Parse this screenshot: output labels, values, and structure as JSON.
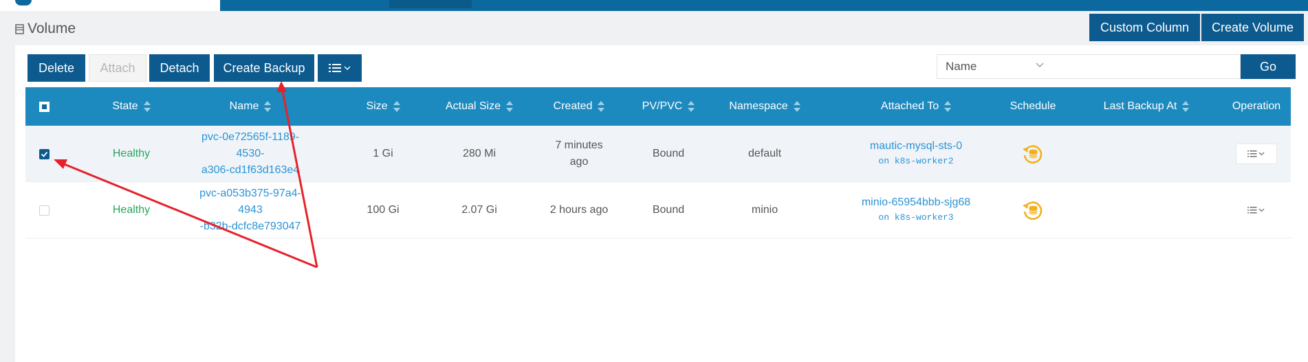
{
  "page": {
    "title": "Volume",
    "custom_column": "Custom Column",
    "create_volume": "Create Volume"
  },
  "toolbar": {
    "delete": "Delete",
    "attach": "Attach",
    "detach": "Detach",
    "create_backup": "Create Backup",
    "more_icon": "list-menu-icon"
  },
  "search": {
    "field": "Name",
    "query": "",
    "go": "Go"
  },
  "table": {
    "columns": [
      "State",
      "Name",
      "Size",
      "Actual Size",
      "Created",
      "PV/PVC",
      "Namespace",
      "Attached To",
      "Schedule",
      "Last Backup At",
      "Operation"
    ],
    "rows": [
      {
        "checked": true,
        "state": "Healthy",
        "name_l1": "pvc-0e72565f-1189-4530-",
        "name_l2": "a306-cd1f63d163e4",
        "size": "1 Gi",
        "actual_size": "280 Mi",
        "created_l1": "7 minutes",
        "created_l2": "ago",
        "pv_pvc": "Bound",
        "namespace": "default",
        "attached_to": "mautic-mysql-sts-0",
        "attached_node": "on k8s-worker2",
        "last_backup_at": ""
      },
      {
        "checked": false,
        "state": "Healthy",
        "name_l1": "pvc-a053b375-97a4-4943",
        "name_l2": "-b32b-dcfc8e793047",
        "size": "100 Gi",
        "actual_size": "2.07 Gi",
        "created_l1": "2 hours ago",
        "created_l2": "",
        "pv_pvc": "Bound",
        "namespace": "minio",
        "attached_to": "minio-65954bbb-sjg68",
        "attached_node": "on k8s-worker3",
        "last_backup_at": ""
      }
    ]
  },
  "colors": {
    "primary": "#0c5a8e",
    "header": "#1d8abf",
    "healthy": "#26a65b",
    "link": "#2a93d5",
    "schedule": "#f2b01e",
    "annotation": "#e8202a"
  }
}
